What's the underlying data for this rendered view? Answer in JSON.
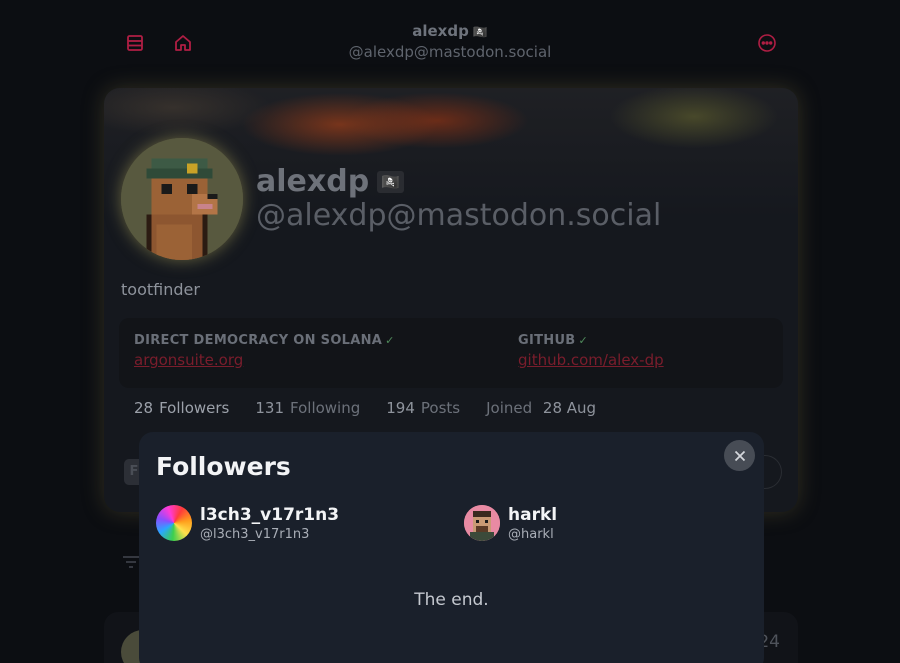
{
  "header": {
    "name": "alexdp",
    "flag_emoji": "🏴‍☠️",
    "handle": "@alexdp@mastodon.social",
    "icons": [
      "list-icon",
      "home-icon",
      "more-options-icon"
    ],
    "accent_color": "#b01e44"
  },
  "profile": {
    "display_name": "alexdp",
    "flag_emoji": "🏴‍☠️",
    "handle": "@alexdp@mastodon.social",
    "bio": "tootfinder",
    "fields": [
      {
        "label": "DIRECT DEMOCRACY ON SOLANA",
        "value": "argonsuite.org",
        "verified": true
      },
      {
        "label": "GITHUB",
        "value": "github.com/alex-dp",
        "verified": true
      }
    ],
    "stats": {
      "followers_count": "28",
      "followers_label": "Followers",
      "following_count": "131",
      "following_label": "Following",
      "posts_count": "194",
      "posts_label": "Posts",
      "joined_label": "Joined",
      "joined_date": "28 Aug"
    },
    "tab_fragment": "F"
  },
  "post_preview": {
    "date_fragment": "24"
  },
  "modal": {
    "title": "Followers",
    "followers": [
      {
        "name": "l3ch3_v17r1n3",
        "handle": "@l3ch3_v17r1n3"
      },
      {
        "name": "harkl",
        "handle": "@harkl"
      }
    ],
    "end_text": "The end."
  }
}
